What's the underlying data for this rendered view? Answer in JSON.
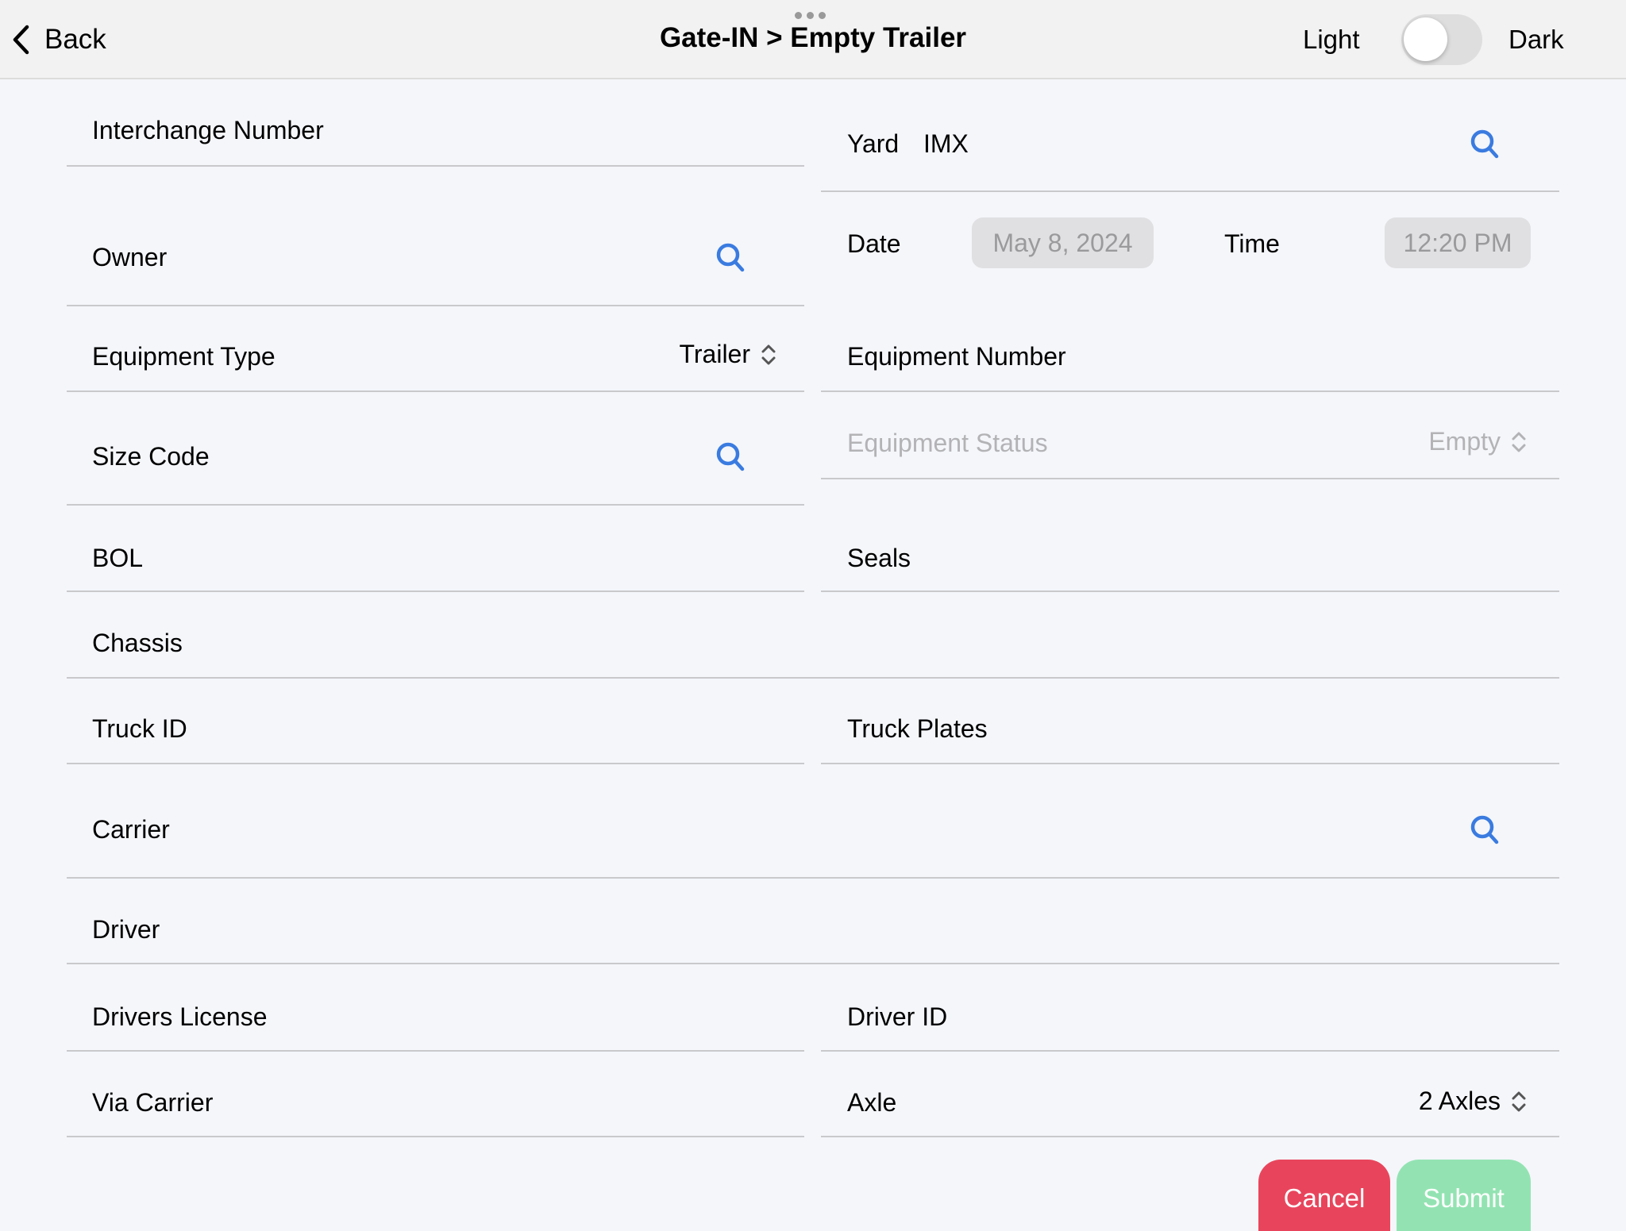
{
  "header": {
    "back_label": "Back",
    "title": "Gate-IN > Empty Trailer",
    "theme_light_label": "Light",
    "theme_dark_label": "Dark",
    "theme_toggle_on": false
  },
  "form": {
    "interchange_number": {
      "label": "Interchange Number",
      "value": ""
    },
    "yard": {
      "label": "Yard",
      "value": "IMX"
    },
    "owner": {
      "label": "Owner",
      "value": ""
    },
    "date": {
      "label": "Date",
      "value": "May 8, 2024"
    },
    "time": {
      "label": "Time",
      "value": "12:20 PM"
    },
    "equipment_type": {
      "label": "Equipment Type",
      "value": "Trailer"
    },
    "equipment_number": {
      "label": "Equipment Number",
      "value": ""
    },
    "size_code": {
      "label": "Size Code",
      "value": ""
    },
    "equipment_status": {
      "label": "Equipment Status",
      "value": "Empty",
      "disabled": true
    },
    "bol": {
      "label": "BOL",
      "value": ""
    },
    "seals": {
      "label": "Seals",
      "value": ""
    },
    "chassis": {
      "label": "Chassis",
      "value": ""
    },
    "truck_id": {
      "label": "Truck ID",
      "value": ""
    },
    "truck_plates": {
      "label": "Truck Plates",
      "value": ""
    },
    "carrier": {
      "label": "Carrier",
      "value": ""
    },
    "driver": {
      "label": "Driver",
      "value": ""
    },
    "drivers_license": {
      "label": "Drivers License",
      "value": ""
    },
    "driver_id": {
      "label": "Driver ID",
      "value": ""
    },
    "via_carrier": {
      "label": "Via Carrier",
      "value": ""
    },
    "axle": {
      "label": "Axle",
      "value": "2 Axles"
    }
  },
  "actions": {
    "cancel_label": "Cancel",
    "submit_label": "Submit"
  },
  "colors": {
    "accent": "#3a7be0",
    "cancel": "#e8455c",
    "submit": "#93e3b2"
  }
}
